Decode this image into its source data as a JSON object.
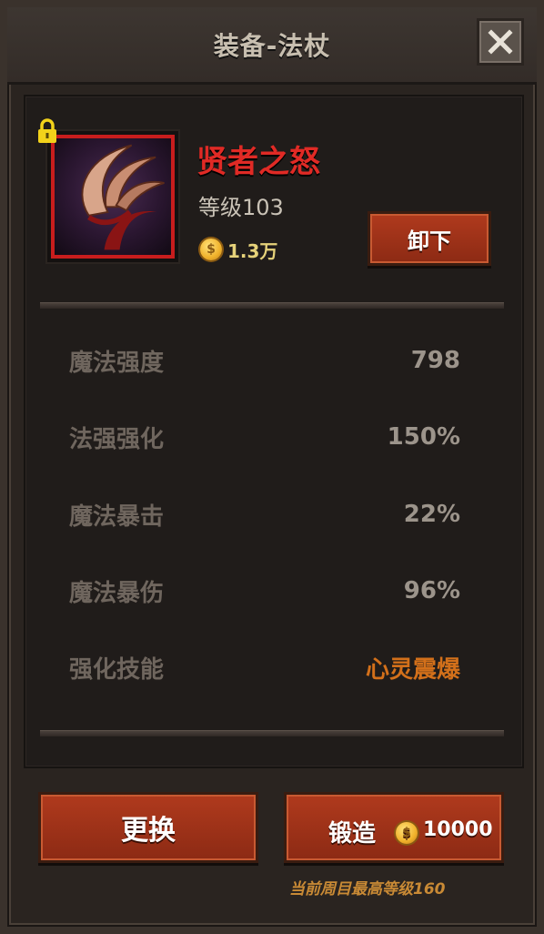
{
  "title": "装备-法杖",
  "item": {
    "name": "贤者之怒",
    "level_label": "等级103",
    "price": "1.3万",
    "rarity_color": "#c81d1d",
    "locked_icon": "lock-icon"
  },
  "buttons": {
    "unequip": "卸下",
    "change": "更换",
    "forge": "锻造",
    "forge_cost": "10000"
  },
  "stats": [
    {
      "label": "魔法强度",
      "value": "798"
    },
    {
      "label": "法强强化",
      "value": "150%"
    },
    {
      "label": "魔法暴击",
      "value": "22%"
    },
    {
      "label": "魔法暴伤",
      "value": "96%"
    },
    {
      "label": "强化技能",
      "value": "心灵震爆"
    }
  ],
  "footnote": "当前周目最高等级160",
  "colors": {
    "accent_red": "#e02a25",
    "button": "#9a3218",
    "skill_highlight": "#d3701a",
    "coin": "#f0b12a"
  }
}
